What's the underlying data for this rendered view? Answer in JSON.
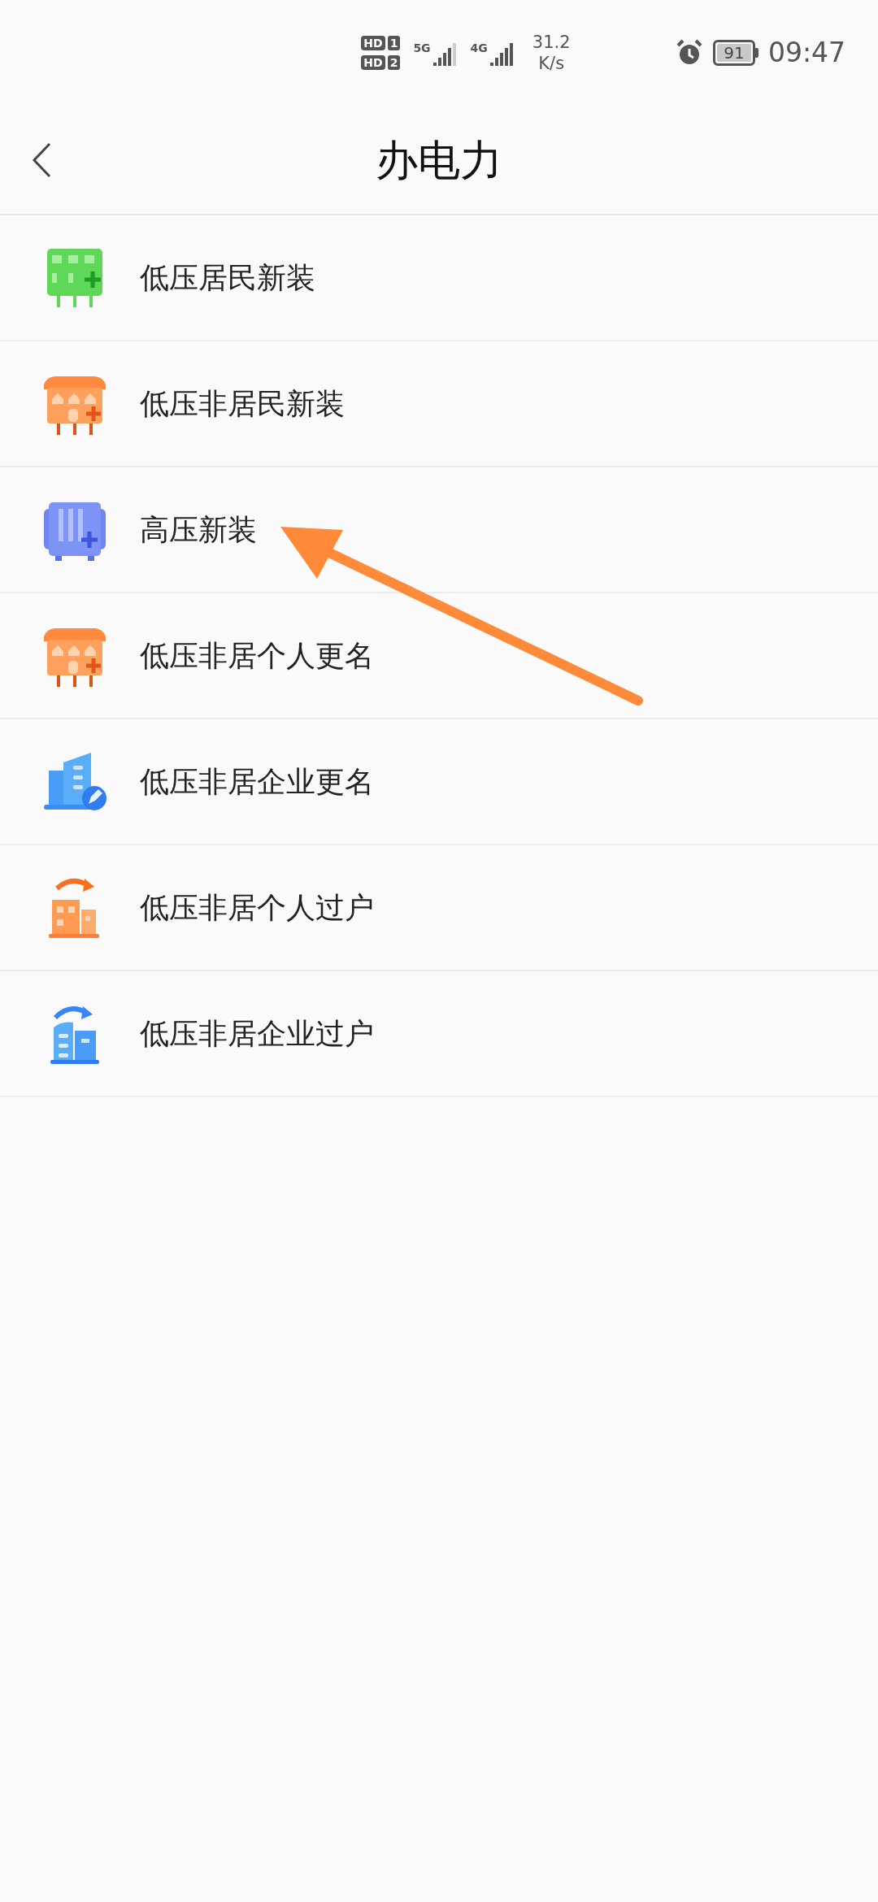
{
  "status_bar": {
    "sims": [
      {
        "badge": "HD",
        "slot": "1",
        "network": "5G"
      },
      {
        "badge": "HD",
        "slot": "2",
        "network": "4G"
      }
    ],
    "speed": "31.2",
    "speed_unit": "K/s",
    "battery": "91",
    "time": "09:47"
  },
  "nav": {
    "title": "办电力"
  },
  "items": [
    {
      "label": "低压居民新装",
      "kind": "green-box"
    },
    {
      "label": "低压非居民新装",
      "kind": "orange-shop"
    },
    {
      "label": "高压新装",
      "kind": "blue-box"
    },
    {
      "label": "低压非居个人更名",
      "kind": "orange-shop"
    },
    {
      "label": "低压非居企业更名",
      "kind": "blue-building-edit"
    },
    {
      "label": "低压非居个人过户",
      "kind": "orange-building-move"
    },
    {
      "label": "低压非居企业过户",
      "kind": "blue-building-move"
    }
  ]
}
